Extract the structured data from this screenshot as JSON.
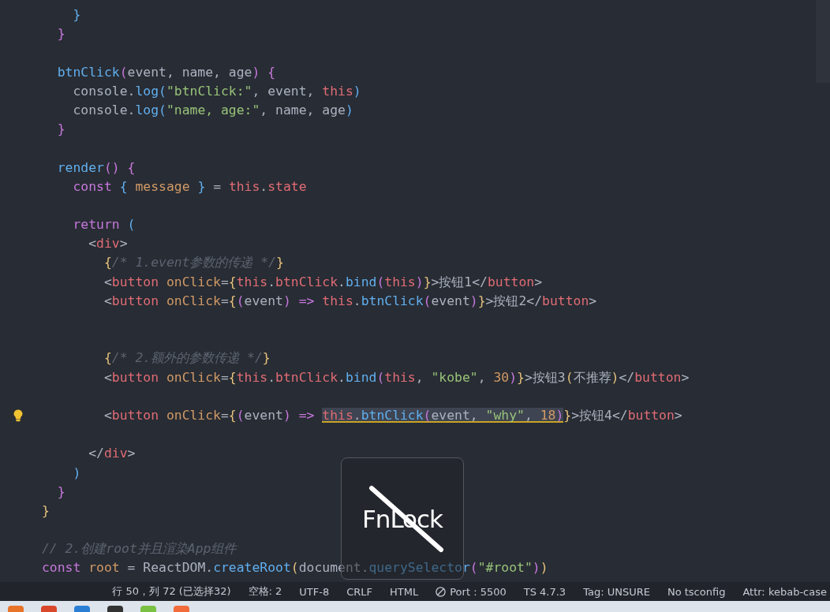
{
  "editor": {
    "lines": [
      {
        "kind": "code",
        "lightbulb": false,
        "parts": [
          {
            "selected": false,
            "tokens": [
              {
                "kind": "b3",
                "text": "    }"
              }
            ]
          }
        ]
      },
      {
        "kind": "code",
        "lightbulb": false,
        "parts": [
          {
            "selected": false,
            "tokens": [
              {
                "kind": "b2",
                "text": "  }"
              }
            ]
          }
        ]
      },
      {
        "kind": "blank"
      },
      {
        "kind": "code",
        "lightbulb": false,
        "parts": [
          {
            "selected": false,
            "tokens": [
              {
                "kind": "fn",
                "text": "  btnClick"
              },
              {
                "kind": "b2",
                "text": "("
              },
              {
                "kind": "p",
                "text": "event, name, age"
              },
              {
                "kind": "b2",
                "text": ") {"
              }
            ]
          }
        ]
      },
      {
        "kind": "code",
        "lightbulb": false,
        "parts": [
          {
            "selected": false,
            "tokens": [
              {
                "kind": "p",
                "text": "    console."
              },
              {
                "kind": "fn",
                "text": "log"
              },
              {
                "kind": "b3",
                "text": "("
              },
              {
                "kind": "str",
                "text": "\"btnClick:\""
              },
              {
                "kind": "p",
                "text": ", event, "
              },
              {
                "kind": "red",
                "text": "this"
              },
              {
                "kind": "b3",
                "text": ")"
              }
            ]
          }
        ]
      },
      {
        "kind": "code",
        "lightbulb": false,
        "parts": [
          {
            "selected": false,
            "tokens": [
              {
                "kind": "p",
                "text": "    console."
              },
              {
                "kind": "fn",
                "text": "log"
              },
              {
                "kind": "b3",
                "text": "("
              },
              {
                "kind": "str",
                "text": "\"name, age:\""
              },
              {
                "kind": "p",
                "text": ", name, age"
              },
              {
                "kind": "b3",
                "text": ")"
              }
            ]
          }
        ]
      },
      {
        "kind": "code",
        "lightbulb": false,
        "parts": [
          {
            "selected": false,
            "tokens": [
              {
                "kind": "b2",
                "text": "  }"
              }
            ]
          }
        ]
      },
      {
        "kind": "blank"
      },
      {
        "kind": "code",
        "lightbulb": false,
        "parts": [
          {
            "selected": false,
            "tokens": [
              {
                "kind": "fn",
                "text": "  render"
              },
              {
                "kind": "b2",
                "text": "() {"
              }
            ]
          }
        ]
      },
      {
        "kind": "code",
        "lightbulb": false,
        "parts": [
          {
            "selected": false,
            "tokens": [
              {
                "kind": "kw",
                "text": "    const "
              },
              {
                "kind": "b3",
                "text": "{ "
              },
              {
                "kind": "var",
                "text": "message "
              },
              {
                "kind": "b3",
                "text": "}"
              },
              {
                "kind": "p",
                "text": " = "
              },
              {
                "kind": "red",
                "text": "this"
              },
              {
                "kind": "p",
                "text": "."
              },
              {
                "kind": "red",
                "text": "state"
              }
            ]
          }
        ]
      },
      {
        "kind": "blank"
      },
      {
        "kind": "code",
        "lightbulb": false,
        "parts": [
          {
            "selected": false,
            "tokens": [
              {
                "kind": "kw",
                "text": "    return "
              },
              {
                "kind": "b3",
                "text": "("
              }
            ]
          }
        ]
      },
      {
        "kind": "code",
        "lightbulb": false,
        "parts": [
          {
            "selected": false,
            "tokens": [
              {
                "kind": "p",
                "text": "      <"
              },
              {
                "kind": "red",
                "text": "div"
              },
              {
                "kind": "p",
                "text": ">"
              }
            ]
          }
        ]
      },
      {
        "kind": "code",
        "lightbulb": false,
        "parts": [
          {
            "selected": false,
            "tokens": [
              {
                "kind": "b1",
                "text": "        {"
              },
              {
                "kind": "cm",
                "text": "/* 1.event参数的传递 */"
              },
              {
                "kind": "b1",
                "text": "}"
              }
            ]
          }
        ]
      },
      {
        "kind": "code",
        "lightbulb": false,
        "parts": [
          {
            "selected": false,
            "tokens": [
              {
                "kind": "p",
                "text": "        <"
              },
              {
                "kind": "red",
                "text": "button "
              },
              {
                "kind": "var",
                "text": "onClick"
              },
              {
                "kind": "p",
                "text": "="
              },
              {
                "kind": "b1",
                "text": "{"
              },
              {
                "kind": "red",
                "text": "this"
              },
              {
                "kind": "p",
                "text": "."
              },
              {
                "kind": "red",
                "text": "btnClick"
              },
              {
                "kind": "p",
                "text": "."
              },
              {
                "kind": "fn",
                "text": "bind"
              },
              {
                "kind": "b2",
                "text": "("
              },
              {
                "kind": "red",
                "text": "this"
              },
              {
                "kind": "b2",
                "text": ")"
              },
              {
                "kind": "b1",
                "text": "}"
              },
              {
                "kind": "p",
                "text": ">按钮1</"
              },
              {
                "kind": "red",
                "text": "button"
              },
              {
                "kind": "p",
                "text": ">"
              }
            ]
          }
        ]
      },
      {
        "kind": "code",
        "lightbulb": false,
        "parts": [
          {
            "selected": false,
            "tokens": [
              {
                "kind": "p",
                "text": "        <"
              },
              {
                "kind": "red",
                "text": "button "
              },
              {
                "kind": "var",
                "text": "onClick"
              },
              {
                "kind": "p",
                "text": "="
              },
              {
                "kind": "b1",
                "text": "{"
              },
              {
                "kind": "b2",
                "text": "("
              },
              {
                "kind": "p",
                "text": "event"
              },
              {
                "kind": "b2",
                "text": ") "
              },
              {
                "kind": "kw",
                "text": "=> "
              },
              {
                "kind": "red",
                "text": "this"
              },
              {
                "kind": "p",
                "text": "."
              },
              {
                "kind": "fn",
                "text": "btnClick"
              },
              {
                "kind": "b2",
                "text": "("
              },
              {
                "kind": "p",
                "text": "event"
              },
              {
                "kind": "b2",
                "text": ")"
              },
              {
                "kind": "b1",
                "text": "}"
              },
              {
                "kind": "p",
                "text": ">按钮2</"
              },
              {
                "kind": "red",
                "text": "button"
              },
              {
                "kind": "p",
                "text": ">"
              }
            ]
          }
        ]
      },
      {
        "kind": "blank"
      },
      {
        "kind": "blank"
      },
      {
        "kind": "code",
        "lightbulb": false,
        "parts": [
          {
            "selected": false,
            "tokens": [
              {
                "kind": "b1",
                "text": "        {"
              },
              {
                "kind": "cm",
                "text": "/* 2.额外的参数传递 */"
              },
              {
                "kind": "b1",
                "text": "}"
              }
            ]
          }
        ]
      },
      {
        "kind": "code",
        "lightbulb": false,
        "parts": [
          {
            "selected": false,
            "tokens": [
              {
                "kind": "p",
                "text": "        <"
              },
              {
                "kind": "red",
                "text": "button "
              },
              {
                "kind": "var",
                "text": "onClick"
              },
              {
                "kind": "p",
                "text": "="
              },
              {
                "kind": "b1",
                "text": "{"
              },
              {
                "kind": "red",
                "text": "this"
              },
              {
                "kind": "p",
                "text": "."
              },
              {
                "kind": "red",
                "text": "btnClick"
              },
              {
                "kind": "p",
                "text": "."
              },
              {
                "kind": "fn",
                "text": "bind"
              },
              {
                "kind": "b2",
                "text": "("
              },
              {
                "kind": "red",
                "text": "this"
              },
              {
                "kind": "p",
                "text": ", "
              },
              {
                "kind": "str",
                "text": "\"kobe\""
              },
              {
                "kind": "p",
                "text": ", "
              },
              {
                "kind": "num",
                "text": "30"
              },
              {
                "kind": "b2",
                "text": ")"
              },
              {
                "kind": "b1",
                "text": "}"
              },
              {
                "kind": "p",
                "text": ">按钮3"
              },
              {
                "kind": "b1",
                "text": "("
              },
              {
                "kind": "p",
                "text": "不推荐"
              },
              {
                "kind": "b1",
                "text": ")"
              },
              {
                "kind": "p",
                "text": "</"
              },
              {
                "kind": "red",
                "text": "button"
              },
              {
                "kind": "p",
                "text": ">"
              }
            ]
          }
        ]
      },
      {
        "kind": "blank"
      },
      {
        "kind": "code",
        "lightbulb": true,
        "parts": [
          {
            "selected": false,
            "tokens": [
              {
                "kind": "p",
                "text": "        <"
              },
              {
                "kind": "red",
                "text": "button "
              },
              {
                "kind": "var",
                "text": "onClick"
              },
              {
                "kind": "p",
                "text": "="
              },
              {
                "kind": "b1",
                "text": "{"
              },
              {
                "kind": "b2",
                "text": "("
              },
              {
                "kind": "p",
                "text": "event"
              },
              {
                "kind": "b2",
                "text": ") "
              },
              {
                "kind": "kw",
                "text": "=> "
              }
            ]
          },
          {
            "selected": true,
            "tokens": [
              {
                "kind": "red",
                "text": "this"
              },
              {
                "kind": "p",
                "text": "."
              },
              {
                "kind": "fn",
                "text": "btnClick"
              },
              {
                "kind": "b2",
                "text": "("
              },
              {
                "kind": "p",
                "text": "event, "
              },
              {
                "kind": "str",
                "text": "\"why\""
              },
              {
                "kind": "p",
                "text": ", "
              },
              {
                "kind": "num",
                "text": "18"
              },
              {
                "kind": "b2",
                "text": ")"
              }
            ]
          },
          {
            "selected": false,
            "tokens": [
              {
                "kind": "b1",
                "text": "}"
              },
              {
                "kind": "p",
                "text": ">按钮4</"
              },
              {
                "kind": "red",
                "text": "button"
              },
              {
                "kind": "p",
                "text": ">"
              }
            ]
          }
        ]
      },
      {
        "kind": "blank"
      },
      {
        "kind": "code",
        "lightbulb": false,
        "parts": [
          {
            "selected": false,
            "tokens": [
              {
                "kind": "p",
                "text": "      </"
              },
              {
                "kind": "red",
                "text": "div"
              },
              {
                "kind": "p",
                "text": ">"
              }
            ]
          }
        ]
      },
      {
        "kind": "code",
        "lightbulb": false,
        "parts": [
          {
            "selected": false,
            "tokens": [
              {
                "kind": "b3",
                "text": "    )"
              }
            ]
          }
        ]
      },
      {
        "kind": "code",
        "lightbulb": false,
        "parts": [
          {
            "selected": false,
            "tokens": [
              {
                "kind": "b2",
                "text": "  }"
              }
            ]
          }
        ]
      },
      {
        "kind": "code",
        "lightbulb": false,
        "parts": [
          {
            "selected": false,
            "tokens": [
              {
                "kind": "b1",
                "text": "}"
              }
            ]
          }
        ]
      },
      {
        "kind": "blank"
      },
      {
        "kind": "code",
        "lightbulb": false,
        "parts": [
          {
            "selected": false,
            "tokens": [
              {
                "kind": "cm",
                "text": "// 2.创建root并且渲染App组件"
              }
            ]
          }
        ]
      },
      {
        "kind": "code",
        "lightbulb": false,
        "parts": [
          {
            "selected": false,
            "tokens": [
              {
                "kind": "kw",
                "text": "const "
              },
              {
                "kind": "var",
                "text": "root"
              },
              {
                "kind": "p",
                "text": " = ReactDOM."
              },
              {
                "kind": "fn",
                "text": "createRoot"
              },
              {
                "kind": "b1",
                "text": "("
              },
              {
                "kind": "p",
                "text": "document."
              },
              {
                "kind": "fn",
                "text": "querySelector"
              },
              {
                "kind": "b2",
                "text": "("
              },
              {
                "kind": "str",
                "text": "\"#root\""
              },
              {
                "kind": "b2",
                "text": ")"
              },
              {
                "kind": "b1",
                "text": ")"
              }
            ]
          }
        ]
      }
    ]
  },
  "osd": {
    "label": "FnLock",
    "struck": true
  },
  "status_bar": [
    {
      "kind": "text",
      "text": "行 50，列 72 (已选择32)"
    },
    {
      "kind": "text",
      "text": "空格: 2"
    },
    {
      "kind": "text",
      "text": "UTF-8"
    },
    {
      "kind": "text",
      "text": "CRLF"
    },
    {
      "kind": "text",
      "text": "HTML"
    },
    {
      "kind": "port",
      "text": "Port : 5500"
    },
    {
      "kind": "text",
      "text": "TS 4.7.3"
    },
    {
      "kind": "text",
      "text": "Tag: UNSURE"
    },
    {
      "kind": "text",
      "text": "No tsconfig"
    },
    {
      "kind": "text",
      "text": "Attr: kebab-case"
    }
  ]
}
